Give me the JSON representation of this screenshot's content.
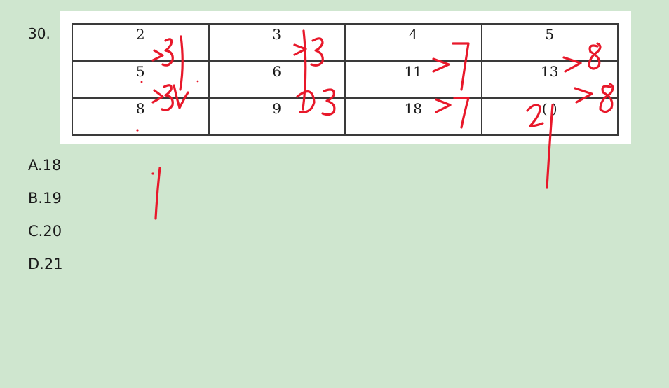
{
  "question": {
    "number": "30."
  },
  "table": {
    "rows": [
      [
        "2",
        "3",
        "4",
        "5"
      ],
      [
        "5",
        "6",
        "11",
        "13"
      ],
      [
        "8",
        "9",
        "18",
        "(   )"
      ]
    ]
  },
  "options": [
    {
      "label": "A.18"
    },
    {
      "label": "B.19"
    },
    {
      "label": "C.20"
    },
    {
      "label": "D.21"
    }
  ],
  "annotations": {
    "ink_color": "#e8182a",
    "handwritten": [
      "3",
      "3",
      "7",
      "8",
      "8",
      "21"
    ]
  }
}
